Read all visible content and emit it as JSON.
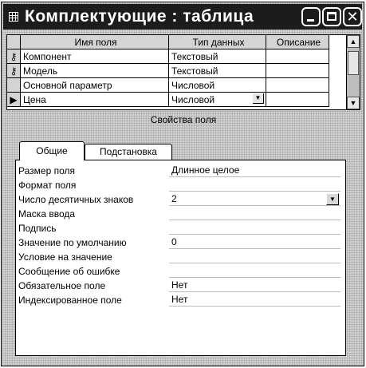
{
  "window": {
    "title": "Комплектующие : таблица",
    "icon": "table-icon"
  },
  "grid": {
    "headers": {
      "name": "Имя поля",
      "type": "Тип данных",
      "desc": "Описание"
    },
    "rows": [
      {
        "marker": "key",
        "name": "Компонент",
        "type": "Текстовый",
        "desc": ""
      },
      {
        "marker": "key",
        "name": "Модель",
        "type": "Текстовый",
        "desc": ""
      },
      {
        "marker": "",
        "name": "Основной параметр",
        "type": "Числовой",
        "desc": ""
      },
      {
        "marker": "current",
        "name": "Цена",
        "type": "Числовой",
        "desc": ""
      }
    ]
  },
  "field_properties_caption": "Свойства поля",
  "tabs": {
    "general": "Общие",
    "lookup": "Подстановка"
  },
  "properties": [
    {
      "label": "Размер поля",
      "value": "Длинное целое"
    },
    {
      "label": "Формат поля",
      "value": ""
    },
    {
      "label": "Число десятичных знаков",
      "value": "2"
    },
    {
      "label": "Маска ввода",
      "value": ""
    },
    {
      "label": "Подпись",
      "value": ""
    },
    {
      "label": "Значение по умолчанию",
      "value": "0"
    },
    {
      "label": "Условие на значение",
      "value": ""
    },
    {
      "label": "Сообщение об ошибке",
      "value": ""
    },
    {
      "label": "Обязательное поле",
      "value": "Нет"
    },
    {
      "label": "Индексированное поле",
      "value": "Нет"
    }
  ]
}
